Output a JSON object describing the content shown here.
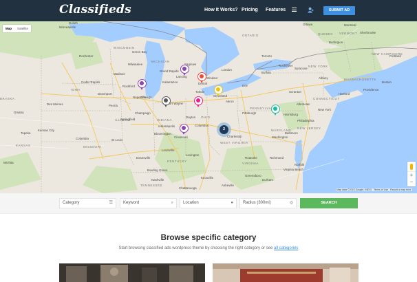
{
  "header": {
    "logo": "Classifieds",
    "nav": [
      "How It Works?",
      "Pricing",
      "Features"
    ],
    "submit_label": "SUBMIT AD"
  },
  "map": {
    "type_controls": [
      "Map",
      "Satellite"
    ],
    "attribution": "Map data ©2015 Google, INEGI",
    "terms": "Terms of Use",
    "report": "Report a map error",
    "labels": {
      "michigan": "MICHIGAN",
      "wisconsin": "WISCONSIN",
      "iowa": "IOWA",
      "illinois": "ILLINOIS",
      "indiana": "INDIANA",
      "ohio": "OHIO",
      "kentucky": "KENTUCKY",
      "tennessee": "TENNESSEE",
      "missouri": "MISSOURI",
      "kansas": "KANSAS",
      "nebraska": "BRASKA",
      "pennsylvania": "PENNSYLVANIA",
      "new_york": "NEW YORK",
      "maryland": "MARYLAND",
      "new_jersey": "NEW JERSEY",
      "west_virginia": "WEST VIRGINIA",
      "virginia": "VIRGINIA",
      "vermont": "VERMONT",
      "new_hampshire": "NEW HAMPSHIRE",
      "massachusetts": "MASSACHUSETTS",
      "connecticut": "CONNECTICUT",
      "quebec": "QUEBEC",
      "ontario": "ONTARIO",
      "chicago": "Chicago",
      "detroit": "Detroit",
      "cleveland": "Cleveland",
      "columbus": "Columbus",
      "cincinnati": "Cincinnati",
      "indianapolis": "Indianapolis",
      "st_louis": "St Louis",
      "milwaukee": "Milwaukee",
      "minneapolis": "Minneapolis",
      "pittsburgh": "Pittsburgh",
      "philadelphia": "Philadelphia",
      "new_york_city": "New York",
      "washington": "Washington",
      "toronto": "Toronto",
      "ottawa": "Ottawa",
      "montreal": "Montreal",
      "boston": "Boston",
      "lansing": "Lansing",
      "grand_rapids": "Grand Rapids",
      "fort_wayne": "Fort Wayne",
      "toledo": "Toledo",
      "louisville": "Louisville",
      "nashville": "Nashville",
      "charleston": "Charleston",
      "richmond": "Richmond",
      "virginia_beach": "Virginia Beach",
      "buffalo": "Buffalo",
      "rochester": "Rochester",
      "albany": "Albany",
      "madison": "Madison",
      "green_bay": "Green Bay",
      "des_moines": "Des Moines",
      "kansas_city": "Kansas City",
      "springfield": "Springfield",
      "peoria": "Peoria",
      "rockford": "Rockford",
      "knoxville": "Knoxville",
      "lexington": "Lexington",
      "dayton": "Dayton",
      "harrisburg": "Harrisburg",
      "baltimore": "Baltimore",
      "hartford": "Hartford",
      "providence": "Providence",
      "portland": "Portland",
      "sherbrooke": "Sherbrooke",
      "burlington": "Burlington",
      "syracuse": "Syracuse",
      "london": "London",
      "windsor": "Windsor",
      "saginaw": "Saginaw",
      "kalamazoo": "Kalamazoo",
      "duluth": "Duluth",
      "rochester_mn": "Rochester",
      "wichita": "Wichita",
      "omaha": "Omaha",
      "topeka": "Topeka",
      "columbia": "Columbia",
      "evansville": "Evansville",
      "bowling_green": "Bowling Green",
      "chattanooga": "Chattanooga",
      "asheville": "Asheville",
      "roanoke": "Roanoke",
      "greensboro": "Greensboro",
      "durham": "Durham",
      "norfolk": "Norfolk",
      "cedar_rapids": "Cedar Rapids",
      "davenport": "Davenport",
      "naperville": "Naperville",
      "champaign": "Champaign",
      "bloomington": "Bloomington",
      "akron": "Akron",
      "erie": "Erie",
      "allentown": "Allentown",
      "scranton": "Scranton"
    },
    "cluster_count": "2"
  },
  "search": {
    "category": "Category",
    "keyword": "Keyword",
    "location": "Location",
    "radius": "Radius (300mi)",
    "button": "SEARCH"
  },
  "content": {
    "title": "Browse specific category",
    "subtitle": "Start browsing classified ads wordpress theme by choosing the right category or see",
    "link": "all categories"
  },
  "colors": {
    "header_bg": "#213140",
    "accent_blue": "#3f8fe0",
    "search_green": "#5cb85c",
    "pin_purple": "#8e44ad"
  }
}
